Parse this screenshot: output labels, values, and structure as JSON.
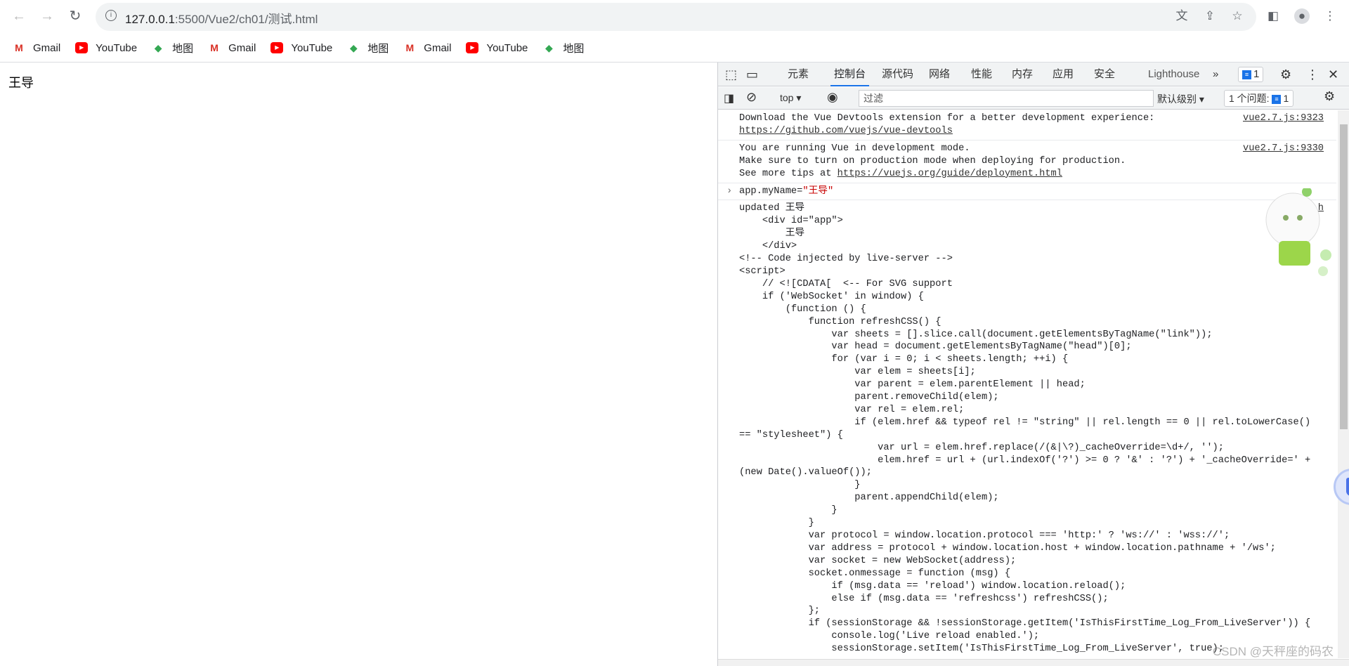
{
  "browser": {
    "url_host": "127.0.0.1",
    "url_rest": ":5500/Vue2/ch01/测试.html"
  },
  "bookmarks": [
    {
      "label": "Gmail",
      "icon": "gmail-icon"
    },
    {
      "label": "YouTube",
      "icon": "youtube-icon"
    },
    {
      "label": "地图",
      "icon": "maps-icon"
    },
    {
      "label": "Gmail",
      "icon": "gmail-icon"
    },
    {
      "label": "YouTube",
      "icon": "youtube-icon"
    },
    {
      "label": "地图",
      "icon": "maps-icon"
    },
    {
      "label": "Gmail",
      "icon": "gmail-icon"
    },
    {
      "label": "YouTube",
      "icon": "youtube-icon"
    },
    {
      "label": "地图",
      "icon": "maps-icon"
    }
  ],
  "page": {
    "text": "王导"
  },
  "devtools": {
    "tabs": [
      "元素",
      "控制台",
      "源代码",
      "网络",
      "性能",
      "内存",
      "应用",
      "安全",
      "Lighthouse"
    ],
    "active_tab": "控制台",
    "issues_badge": "1",
    "toolbar": {
      "context": "top",
      "filter_placeholder": "过滤",
      "level": "默认级别",
      "issues": "1 个问题:",
      "issues_count": "1"
    },
    "messages": [
      {
        "lines": [
          "Download the Vue Devtools extension for a better development experience:"
        ],
        "link": "https://github.com/vuejs/vue-devtools",
        "source": "vue2.7.js:9323"
      },
      {
        "lines": [
          "You are running Vue in development mode.",
          "Make sure to turn on production mode when deploying for production.",
          "See more tips at "
        ],
        "link": "https://vuejs.org/guide/deployment.html",
        "source": "vue2.7.js:9330"
      }
    ],
    "input": {
      "prefix": "app.myName=",
      "value": "\"王导\""
    },
    "output_source": "测试.h",
    "output": "updated 王导\n    <div id=\"app\">\n        王导\n    </div>\n<!-- Code injected by live-server -->\n<script>\n    // <![CDATA[  <-- For SVG support\n    if ('WebSocket' in window) {\n        (function () {\n            function refreshCSS() {\n                var sheets = [].slice.call(document.getElementsByTagName(\"link\"));\n                var head = document.getElementsByTagName(\"head\")[0];\n                for (var i = 0; i < sheets.length; ++i) {\n                    var elem = sheets[i];\n                    var parent = elem.parentElement || head;\n                    parent.removeChild(elem);\n                    var rel = elem.rel;\n                    if (elem.href && typeof rel != \"string\" || rel.length == 0 || rel.toLowerCase()\n== \"stylesheet\") {\n                        var url = elem.href.replace(/(&|\\?)_cacheOverride=\\d+/, '');\n                        elem.href = url + (url.indexOf('?') >= 0 ? '&' : '?') + '_cacheOverride=' +\n(new Date().valueOf());\n                    }\n                    parent.appendChild(elem);\n                }\n            }\n            var protocol = window.location.protocol === 'http:' ? 'ws://' : 'wss://';\n            var address = protocol + window.location.host + window.location.pathname + '/ws';\n            var socket = new WebSocket(address);\n            socket.onmessage = function (msg) {\n                if (msg.data == 'reload') window.location.reload();\n                else if (msg.data == 'refreshcss') refreshCSS();\n            };\n            if (sessionStorage && !sessionStorage.getItem('IsThisFirstTime_Log_From_LiveServer')) {\n                console.log('Live reload enabled.');\n                sessionStorage.setItem('IsThisFirstTime_Log_From_LiveServer', true);"
  },
  "watermark": "CSDN @天秤座的码农"
}
